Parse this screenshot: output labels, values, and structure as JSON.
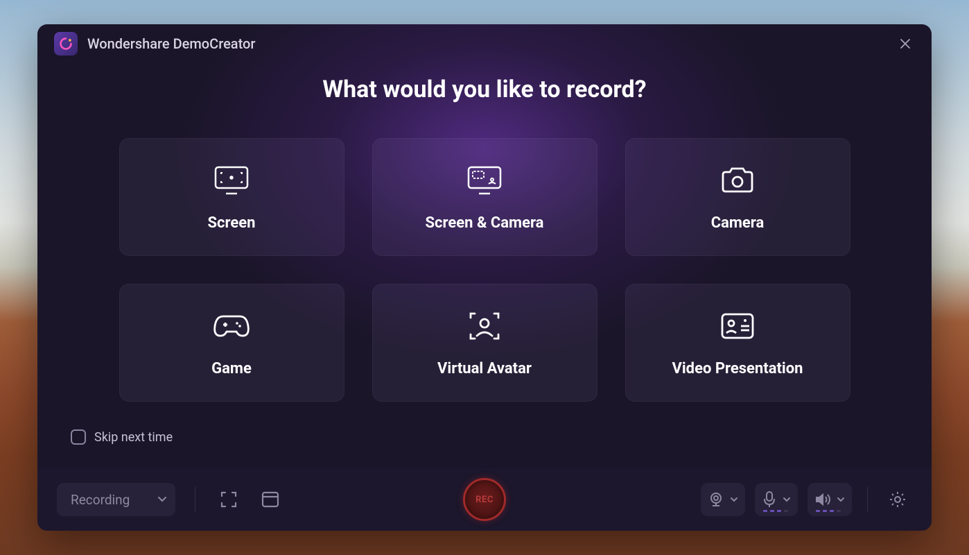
{
  "app": {
    "title": "Wondershare DemoCreator"
  },
  "dialog": {
    "question": "What would you like to record?",
    "options": [
      {
        "id": "screen",
        "label": "Screen"
      },
      {
        "id": "screen-camera",
        "label": "Screen & Camera"
      },
      {
        "id": "camera",
        "label": "Camera"
      },
      {
        "id": "game",
        "label": "Game"
      },
      {
        "id": "virtual-avatar",
        "label": "Virtual Avatar"
      },
      {
        "id": "video-presentation",
        "label": "Video Presentation"
      }
    ],
    "skip_label": "Skip next time",
    "skip_checked": false
  },
  "toolbar": {
    "mode_label": "Recording",
    "rec_label": "REC"
  }
}
